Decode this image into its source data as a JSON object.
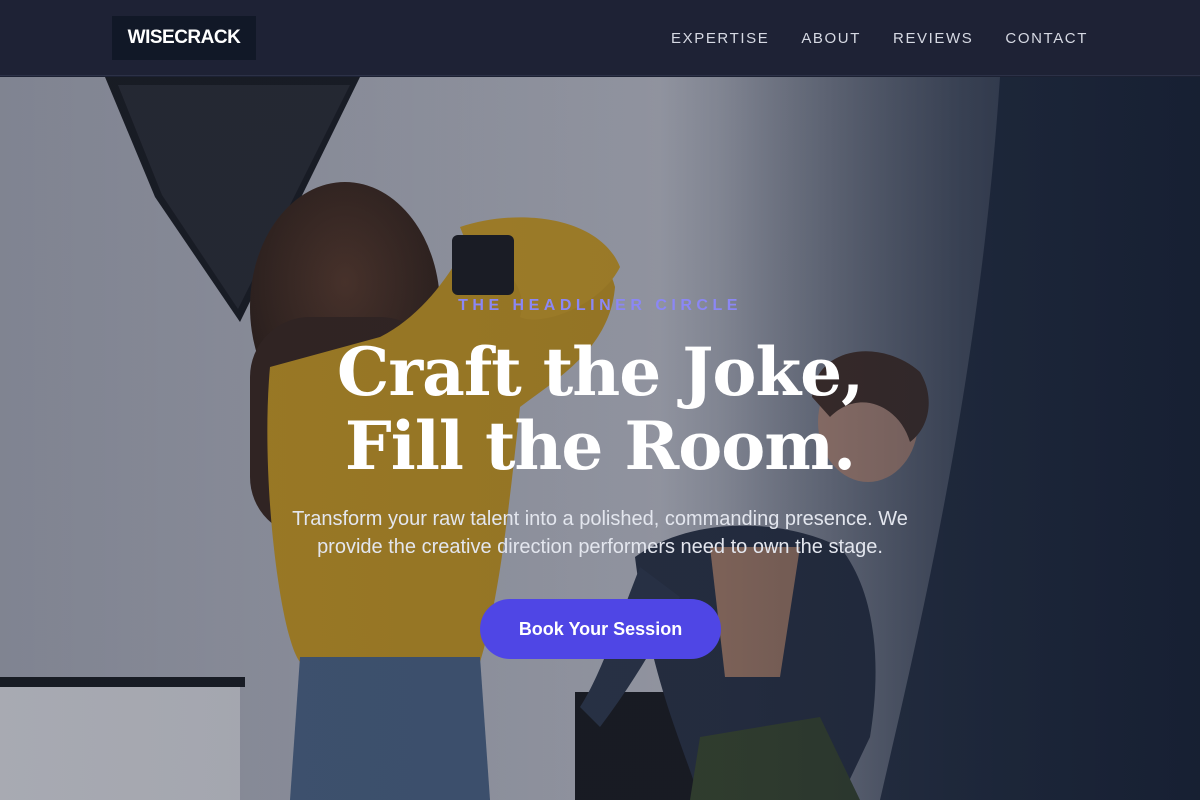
{
  "nav": {
    "logo": "WISECRACK",
    "items": [
      {
        "label": "EXPERTISE"
      },
      {
        "label": "ABOUT"
      },
      {
        "label": "REVIEWS"
      },
      {
        "label": "CONTACT"
      }
    ]
  },
  "hero": {
    "eyebrow": "THE HEADLINER CIRCLE",
    "headline_line1": "Craft the Joke,",
    "headline_line2": "Fill the Room.",
    "subtext": "Transform your raw talent into a polished, commanding presence. We provide the creative direction performers need to own the stage.",
    "cta_label": "Book Your Session"
  },
  "colors": {
    "nav_bg": "#1e2235",
    "logo_bg": "#111827",
    "accent": "#4f46e5",
    "eyebrow": "#8b87f5"
  },
  "icons": [
    "hero-photo"
  ]
}
